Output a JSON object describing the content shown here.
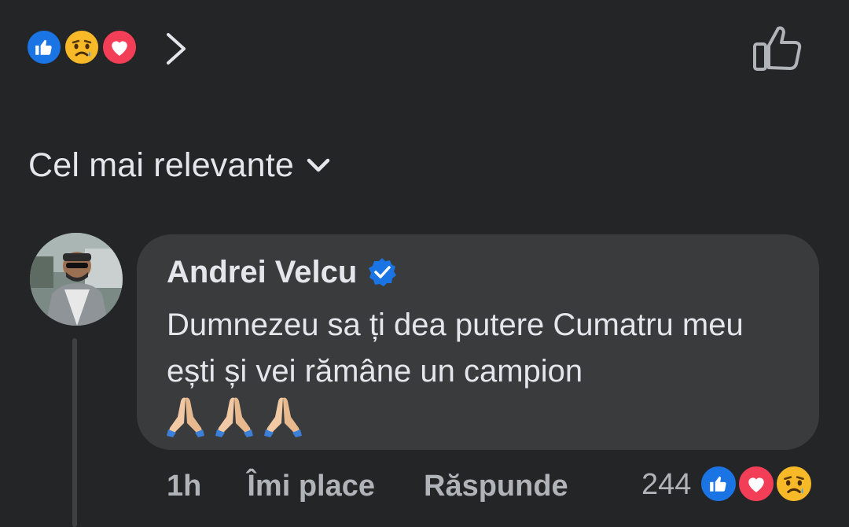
{
  "header": {
    "reactions": [
      "like-icon",
      "sad-icon",
      "love-icon"
    ],
    "next_icon": "chevron-right-icon",
    "like_action_icon": "thumbs-up-outline-icon"
  },
  "sort": {
    "label": "Cel mai relevante",
    "icon": "chevron-down-icon"
  },
  "comment": {
    "author": "Andrei Velcu",
    "verified": true,
    "text": "Dumnezeu sa ți dea putere Cumatru meu ești și vei rămâne un campion",
    "emoji": [
      "🙏",
      "🙏",
      "🙏"
    ],
    "time": "1h",
    "like_label": "Îmi place",
    "reply_label": "Răspunde",
    "reaction_count": "244",
    "reactions": [
      "like-icon",
      "love-icon",
      "sad-icon"
    ]
  },
  "colors": {
    "background": "#242526",
    "bubble": "#3a3b3c",
    "text": "#e4e6eb",
    "secondary_text": "#b0b3b8",
    "like_blue": "#1b74e4",
    "love_red": "#f33e58",
    "sad_yellow": "#f7b928"
  }
}
